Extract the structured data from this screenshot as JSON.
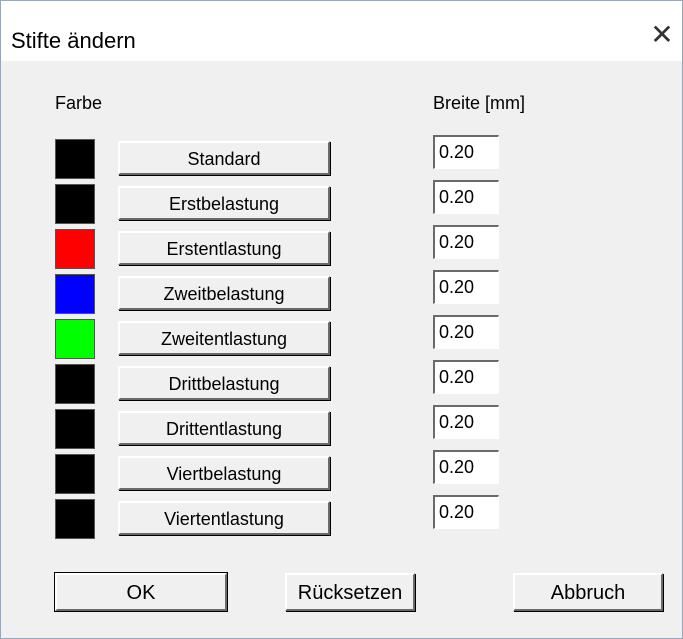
{
  "window": {
    "title": "Stifte ändern",
    "close_glyph": "✕",
    "close_icon": "close-icon"
  },
  "labels": {
    "color": "Farbe",
    "width": "Breite [mm]"
  },
  "pens": [
    {
      "label": "Standard",
      "color": "#000000",
      "width": "0.20"
    },
    {
      "label": "Erstbelastung",
      "color": "#000000",
      "width": "0.20"
    },
    {
      "label": "Erstentlastung",
      "color": "#ff0000",
      "width": "0.20"
    },
    {
      "label": "Zweitbelastung",
      "color": "#0000ff",
      "width": "0.20"
    },
    {
      "label": "Zweitentlastung",
      "color": "#00ff00",
      "width": "0.20"
    },
    {
      "label": "Drittbelastung",
      "color": "#000000",
      "width": "0.20"
    },
    {
      "label": "Drittentlastung",
      "color": "#000000",
      "width": "0.20"
    },
    {
      "label": "Viertbelastung",
      "color": "#000000",
      "width": "0.20"
    },
    {
      "label": "Viertentlastung",
      "color": "#000000",
      "width": "0.20"
    }
  ],
  "buttons": {
    "ok": "OK",
    "reset": "Rücksetzen",
    "cancel": "Abbruch"
  }
}
